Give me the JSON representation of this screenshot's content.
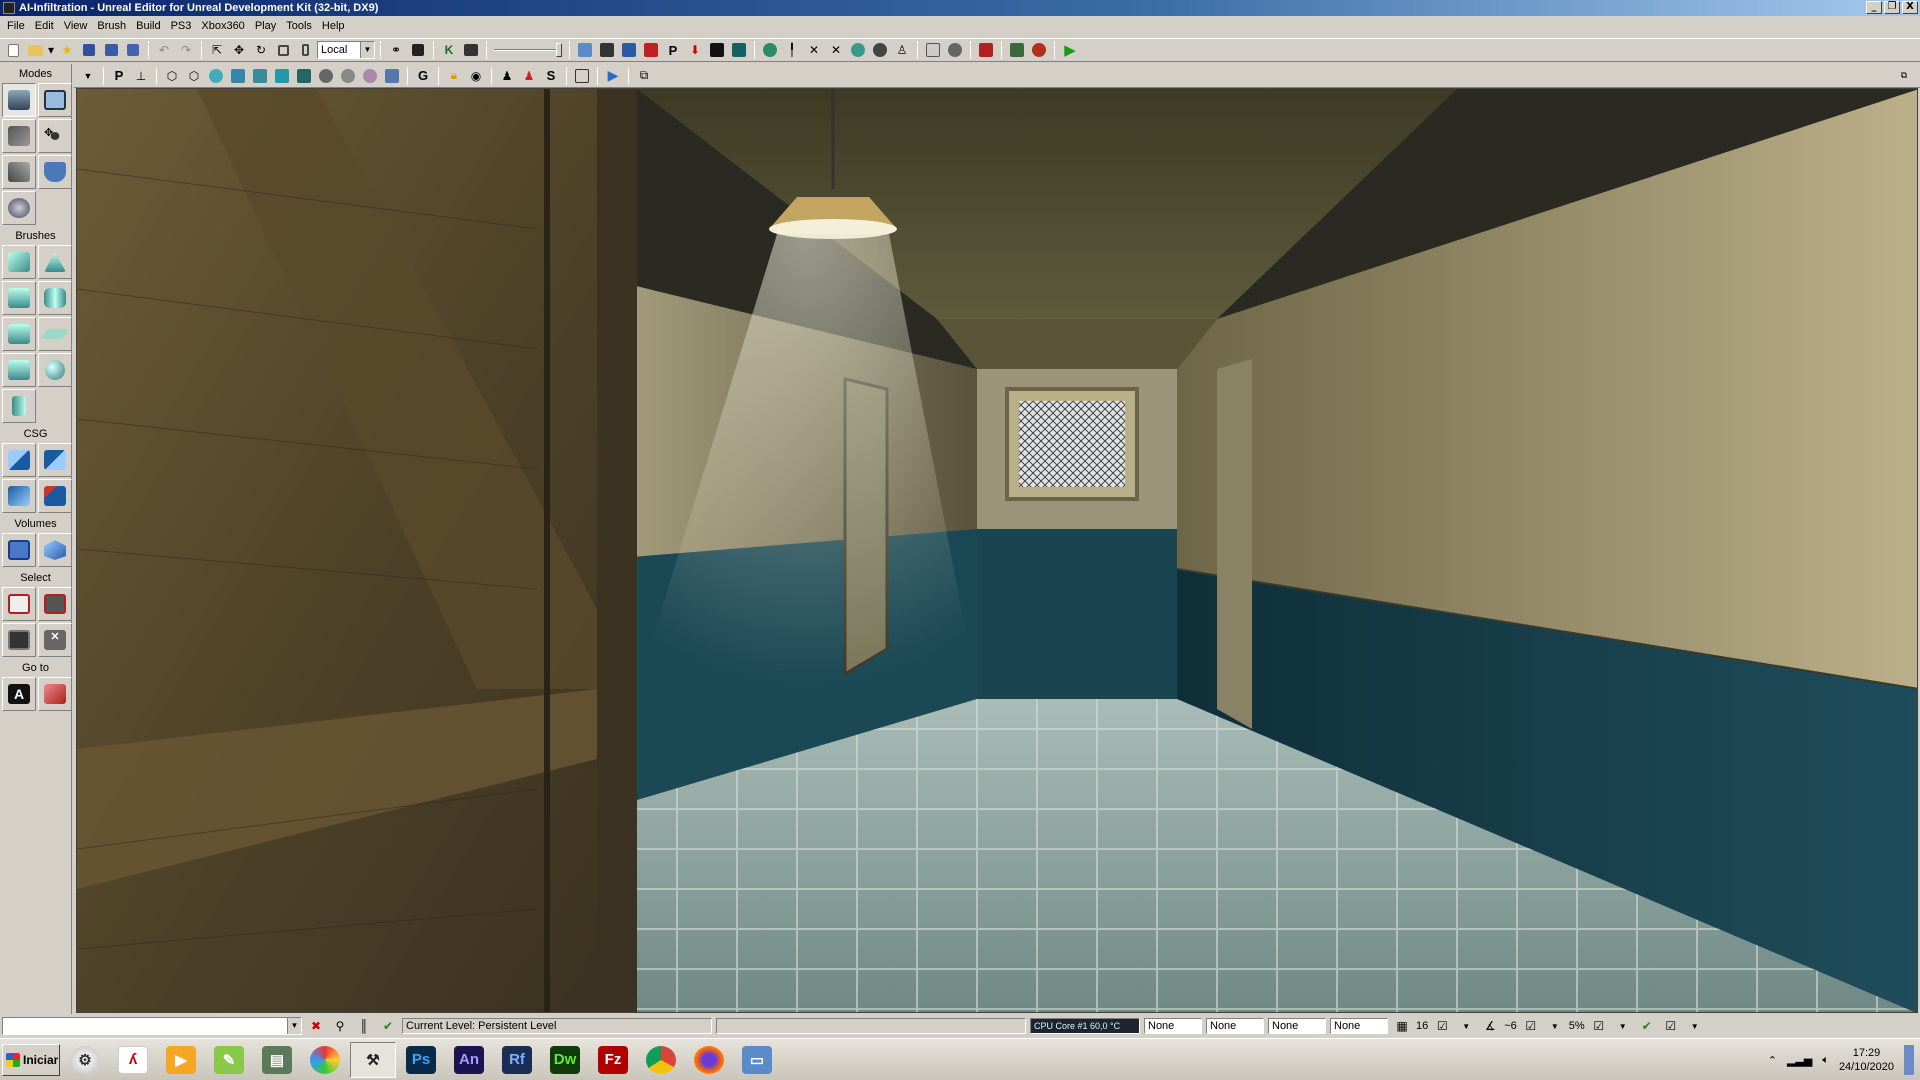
{
  "window": {
    "title": "AI-Infiltration - Unreal Editor for Unreal Development Kit (32-bit, DX9)",
    "controls": [
      "_",
      "❐",
      "X"
    ]
  },
  "menu": [
    "File",
    "Edit",
    "View",
    "Brush",
    "Build",
    "PS3",
    "Xbox360",
    "Play",
    "Tools",
    "Help"
  ],
  "toolbar": {
    "coord_system": "Local"
  },
  "left_panel": {
    "sections": {
      "modes": "Modes",
      "brushes": "Brushes",
      "csg": "CSG",
      "volumes": "Volumes",
      "select": "Select",
      "goto": "Go to"
    }
  },
  "viewport_toolbar": {
    "labels": [
      "P",
      "G",
      "S"
    ]
  },
  "status": {
    "current_level": "Current Level:  Persistent Level",
    "cpu": "CPU Core #1    60,0 °C",
    "fields": [
      "None",
      "None",
      "None",
      "None"
    ],
    "grid_value": "16",
    "rotation_value": "~6",
    "scale_value": "5%"
  },
  "taskbar": {
    "start_label": "Iniciar",
    "apps": [
      {
        "name": "Ps",
        "color": "#0a2a4a",
        "text_color": "#31a8ff"
      },
      {
        "name": "An",
        "color": "#1c1450",
        "text_color": "#9e9eff"
      },
      {
        "name": "Rf",
        "color": "#1a2e55",
        "text_color": "#7ab0ff"
      },
      {
        "name": "Dw",
        "color": "#0f3b0a",
        "text_color": "#5fe83a"
      },
      {
        "name": "Fz",
        "color": "#b00000",
        "text_color": "#ffffff"
      }
    ],
    "time": "17:29",
    "date": "24/10/2020"
  },
  "colors": {
    "title_gradient_start": "#0a246a",
    "title_gradient_end": "#a6caf0",
    "panel_bg": "#d4d0c8",
    "wall_plaster": "#b8ae88",
    "wall_lower": "#1d4a58",
    "floor_tile": "#8fa3a0",
    "wood": "#6b5a35"
  }
}
